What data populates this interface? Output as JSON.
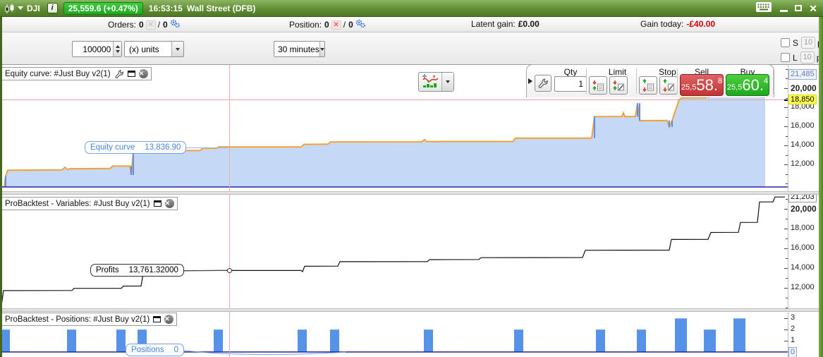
{
  "titlebar": {
    "symbol": "DJI",
    "info_glyph": "i",
    "price_badge": "25,559.6 (+0.47%)",
    "time": "16:53:15",
    "market": "Wall Street (DFB)"
  },
  "statsbar": {
    "orders_label": "Orders:",
    "orders_open": "0",
    "orders_slash": "/",
    "orders_pending": "0",
    "position_label": "Position:",
    "position_open": "0",
    "position_slash": "/",
    "position_pending": "0",
    "latent_gain_label": "Latent gain:",
    "latent_gain_value": "£0.00",
    "gain_today_label": "Gain today:",
    "gain_today_value": "-£40.00"
  },
  "toolbar": {
    "quantity_value": "100000",
    "units_selected": "(x) units",
    "timeframe_selected": "30 minutes",
    "qty_label": "Qty",
    "qty_value": "1",
    "limit_label": "Limit",
    "stop_label": "Stop",
    "sell_label": "Sell",
    "buy_label": "Buy",
    "sell_price_prefix": "25,5",
    "sell_price_main": "58.",
    "sell_price_sup": "8",
    "buy_price_prefix": "25,5",
    "buy_price_main": "60.",
    "buy_price_sup": "4",
    "s_checkbox_label": "S",
    "l_checkbox_label": "L",
    "s_pts_value": "10",
    "l_pts_value": "10",
    "s_pts_unit": "pts",
    "l_pts_unit": "pts"
  },
  "panels": [
    {
      "title": "Equity curve: #Just Buy v2(1)"
    },
    {
      "title": "ProBacktest - Variables: #Just Buy v2(1)"
    },
    {
      "title": "ProBacktest - Positions: #Just Buy v2(1)"
    }
  ],
  "labels": {
    "equity": {
      "name": "Equity curve",
      "value": "13,836.90"
    },
    "profits": {
      "name": "Profits",
      "value": "13,761.32000"
    },
    "positions": {
      "name": "Positions",
      "value": "0"
    }
  },
  "colors": {
    "titlebar_green": "#5d8a31",
    "badge_green": "#2eb82e",
    "sell_red": "#c03434",
    "buy_green": "#1ea81e",
    "loss_red": "#cc0000",
    "equity_fill": "#c5d9f7",
    "equity_line": "#f2a233",
    "jump_blue": "#5b8dee",
    "profit_line": "#111111",
    "bars_blue": "#5592e8",
    "baseline_blue": "#2222aa",
    "crosshair_pink": "#efaaaa",
    "highlight_yellow": "#ffff55",
    "label_blue": "#4a86d8"
  },
  "crosshair_x": 325,
  "chart_data": [
    {
      "type": "area",
      "title": "Equity curve",
      "ylim": [
        9200,
        22440
      ],
      "baseline_v": 9644,
      "yticks": [
        {
          "v": 20000,
          "label": "20,000",
          "bold": true
        },
        {
          "v": 18000,
          "label": "18,000"
        },
        {
          "v": 16000,
          "label": "16,000"
        },
        {
          "v": 14000,
          "label": "14,000"
        },
        {
          "v": 12000,
          "label": "12,000"
        }
      ],
      "minor_tick_step": 1000,
      "hline": {
        "v": 18850,
        "label": "18,850"
      },
      "current": {
        "v": 21485,
        "label": "21,485",
        "style": "blue"
      },
      "points": [
        [
          6,
          9650
        ],
        [
          8,
          10800
        ],
        [
          11,
          11400
        ],
        [
          88,
          11430
        ],
        [
          92,
          11700
        ],
        [
          96,
          11480
        ],
        [
          99,
          11560
        ],
        [
          156,
          11580
        ],
        [
          160,
          11830
        ],
        [
          184,
          11830
        ],
        [
          186,
          10900
        ],
        [
          189,
          13250
        ],
        [
          196,
          13450
        ],
        [
          284,
          13470
        ],
        [
          287,
          13690
        ],
        [
          307,
          13690
        ],
        [
          310,
          13840
        ],
        [
          427,
          13840
        ],
        [
          431,
          14110
        ],
        [
          465,
          14130
        ],
        [
          469,
          14370
        ],
        [
          598,
          14380
        ],
        [
          602,
          14620
        ],
        [
          605,
          14400
        ],
        [
          727,
          14410
        ],
        [
          731,
          14760
        ],
        [
          839,
          14770
        ],
        [
          843,
          17020
        ],
        [
          882,
          17030
        ],
        [
          884,
          17400
        ],
        [
          886,
          17030
        ],
        [
          901,
          17030
        ],
        [
          904,
          18430
        ],
        [
          907,
          16600
        ],
        [
          946,
          16610
        ],
        [
          949,
          15930
        ],
        [
          953,
          16600
        ],
        [
          963,
          18800
        ],
        [
          967,
          18980
        ],
        [
          1001,
          18990
        ],
        [
          1005,
          20600
        ],
        [
          1029,
          20610
        ],
        [
          1033,
          20050
        ],
        [
          1036,
          20520
        ],
        [
          1039,
          20120
        ],
        [
          1043,
          20560
        ],
        [
          1047,
          20230
        ],
        [
          1052,
          21480
        ],
        [
          1085,
          21485
        ]
      ]
    },
    {
      "type": "line",
      "title": "Profits",
      "ylim": [
        9930,
        21430
      ],
      "yticks": [
        {
          "v": 20000,
          "label": "20,000",
          "bold": true
        },
        {
          "v": 18000,
          "label": "18,000"
        },
        {
          "v": 16000,
          "label": "16,000"
        },
        {
          "v": 14000,
          "label": "14,000"
        },
        {
          "v": 12000,
          "label": "12,000"
        }
      ],
      "minor_tick_step": 1000,
      "current": {
        "v": 21203,
        "label": "21,203",
        "style": "plain"
      },
      "marker": {
        "x": 325,
        "v": 13761.32
      },
      "points": [
        [
          2,
          10250
        ],
        [
          5,
          11720
        ],
        [
          102,
          11740
        ],
        [
          105,
          11950
        ],
        [
          172,
          11960
        ],
        [
          175,
          12180
        ],
        [
          200,
          12190
        ],
        [
          203,
          13430
        ],
        [
          240,
          13600
        ],
        [
          244,
          13720
        ],
        [
          310,
          13761
        ],
        [
          326,
          13761
        ],
        [
          427,
          13765
        ],
        [
          429,
          13640
        ],
        [
          432,
          14190
        ],
        [
          479,
          14200
        ],
        [
          482,
          14650
        ],
        [
          606,
          14660
        ],
        [
          609,
          14860
        ],
        [
          679,
          14870
        ],
        [
          682,
          15060
        ],
        [
          826,
          15070
        ],
        [
          830,
          15810
        ],
        [
          949,
          15820
        ],
        [
          952,
          16900
        ],
        [
          1004,
          16910
        ],
        [
          1008,
          17610
        ],
        [
          1047,
          17620
        ],
        [
          1050,
          18620
        ],
        [
          1074,
          18630
        ],
        [
          1077,
          20700
        ],
        [
          1096,
          20710
        ],
        [
          1099,
          21203
        ],
        [
          1113,
          21203
        ]
      ]
    },
    {
      "type": "bar",
      "title": "Positions",
      "ylim": [
        -0.45,
        3.65
      ],
      "baseline_v": 0,
      "yticks": [
        {
          "v": 3,
          "label": "3"
        },
        {
          "v": 2,
          "label": "2"
        },
        {
          "v": 1,
          "label": "1"
        }
      ],
      "current": {
        "v": 0,
        "label": "0",
        "style": "blue"
      },
      "bars": [
        [
          1,
          13,
          2
        ],
        [
          95,
          13,
          2
        ],
        [
          165,
          13,
          2
        ],
        [
          195,
          13,
          2
        ],
        [
          303,
          13,
          2
        ],
        [
          422,
          13,
          2
        ],
        [
          468,
          13,
          2
        ],
        [
          601,
          13,
          2
        ],
        [
          729,
          13,
          2
        ],
        [
          845,
          13,
          2
        ],
        [
          903,
          13,
          2
        ],
        [
          957,
          17,
          3
        ],
        [
          998,
          17,
          2
        ],
        [
          1040,
          17,
          3
        ]
      ]
    }
  ]
}
